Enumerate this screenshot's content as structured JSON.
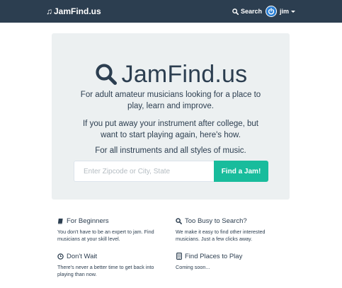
{
  "navbar": {
    "brand": "JamFind.us",
    "search_label": "Search",
    "user_label": "jim"
  },
  "hero": {
    "title": "JamFind.us",
    "line1": "For adult amateur musicians looking for a place to",
    "line1b": "play, learn and improve.",
    "line2": "If you put away your instrument after college, but",
    "line2b": "want to start playing again, here's how.",
    "line3": "For all instruments and all styles of music.",
    "search": {
      "placeholder": "Enter Zipcode or City, State",
      "value": "",
      "button_label": "Find a Jam!"
    }
  },
  "features": [
    {
      "icon": "book-icon",
      "title": "For Beginners",
      "body1": "You don't have to be an expert to jam. Find",
      "body2": "musicians at your skill level."
    },
    {
      "icon": "search-icon",
      "title": "Too Busy to Search?",
      "body1": "We make it easy to find other interested",
      "body2": "musicians. Just a few clicks away."
    },
    {
      "icon": "clock-icon",
      "title": "Don't Wait",
      "body1": "There's never a better time to get back into",
      "body2": "playing than now."
    },
    {
      "icon": "phone-icon",
      "title": "Find Places to Play",
      "body1": "Coming soon...",
      "body2": ""
    }
  ],
  "colors": {
    "navbar": "#2c3e50",
    "jumbotron": "#ecf0f1",
    "primary_button": "#18bc9c",
    "text": "#2c3e50",
    "avatar": "#2a7fd4"
  }
}
